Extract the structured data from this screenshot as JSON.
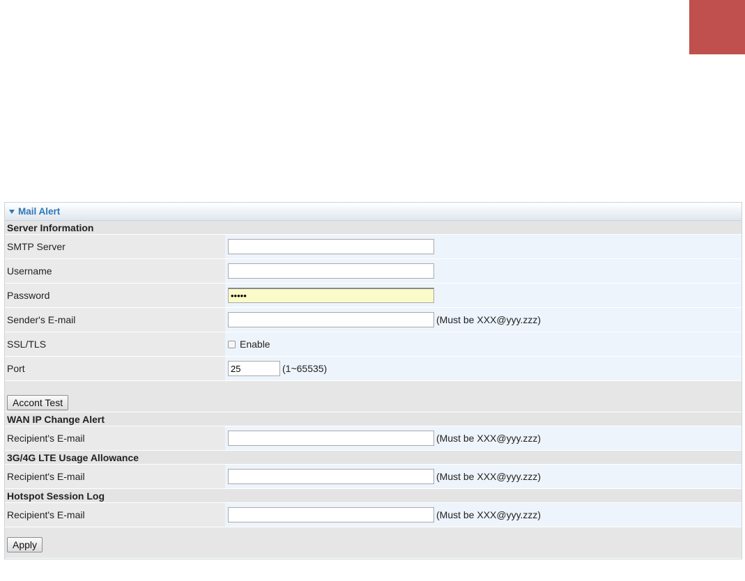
{
  "panel": {
    "title": "Mail Alert"
  },
  "server_info": {
    "header": "Server Information",
    "smtp_server": {
      "label": "SMTP Server",
      "value": ""
    },
    "username": {
      "label": "Username",
      "value": ""
    },
    "password": {
      "label": "Password",
      "value": "•••••"
    },
    "sender_email": {
      "label": "Sender's E-mail",
      "value": "",
      "hint": "(Must be XXX@yyy.zzz)"
    },
    "ssl_tls": {
      "label": "SSL/TLS",
      "checkbox_label": "Enable",
      "checked": false
    },
    "port": {
      "label": "Port",
      "value": "25",
      "hint": "(1~65535)"
    },
    "test_button": "Accont Test"
  },
  "wan_ip_alert": {
    "header": "WAN IP Change Alert",
    "recipient": {
      "label": "Recipient's E-mail",
      "value": "",
      "hint": "(Must be XXX@yyy.zzz)"
    }
  },
  "lte_usage": {
    "header": "3G/4G LTE Usage Allowance",
    "recipient": {
      "label": "Recipient's E-mail",
      "value": "",
      "hint": "(Must be XXX@yyy.zzz)"
    }
  },
  "hotspot_log": {
    "header": "Hotspot Session Log",
    "recipient": {
      "label": "Recipient's E-mail",
      "value": "",
      "hint": "(Must be XXX@yyy.zzz)"
    }
  },
  "apply_button": "Apply",
  "colors": {
    "corner_block": "#c0504d",
    "title_text": "#2f76b6",
    "password_bg": "#fbfbc9"
  }
}
